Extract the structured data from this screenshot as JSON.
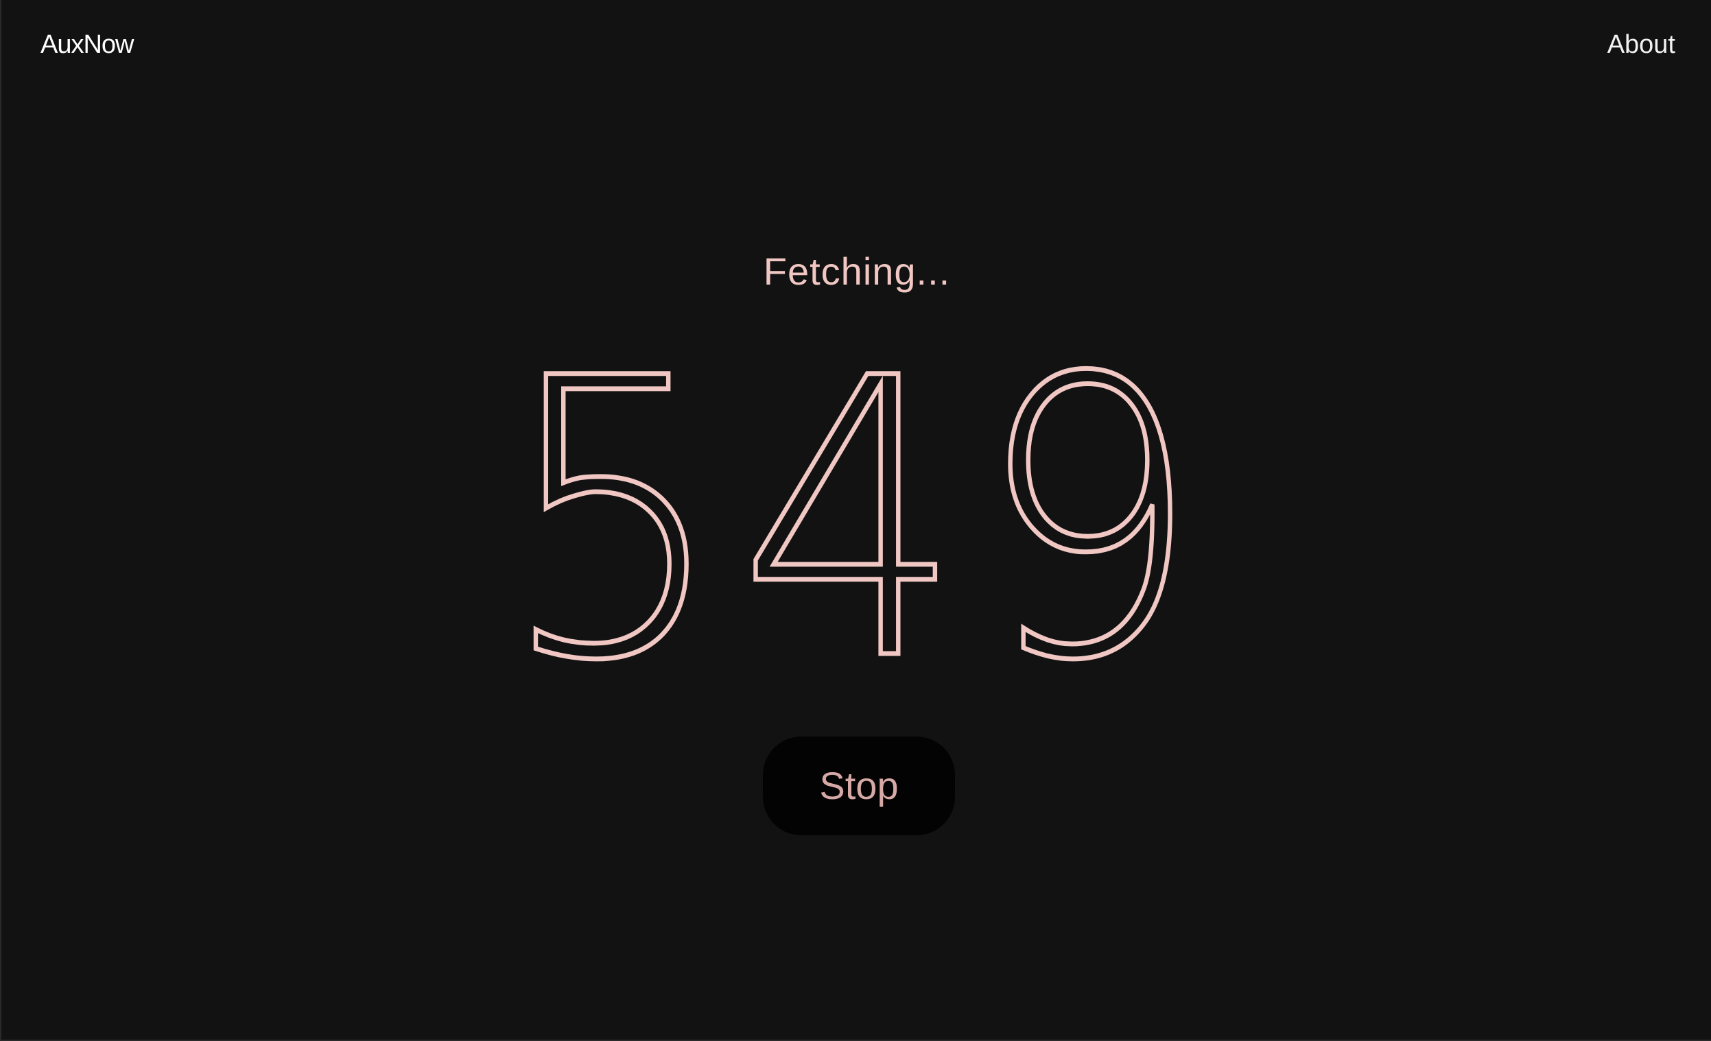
{
  "header": {
    "brand": "AuxNow",
    "about_label": "About"
  },
  "main": {
    "status_text": "Fetching...",
    "counter_value": "549",
    "stop_label": "Stop"
  },
  "colors": {
    "background": "#121212",
    "accent": "#f0c7c3",
    "button_background": "#030303",
    "button_text": "#d7a9a6"
  }
}
